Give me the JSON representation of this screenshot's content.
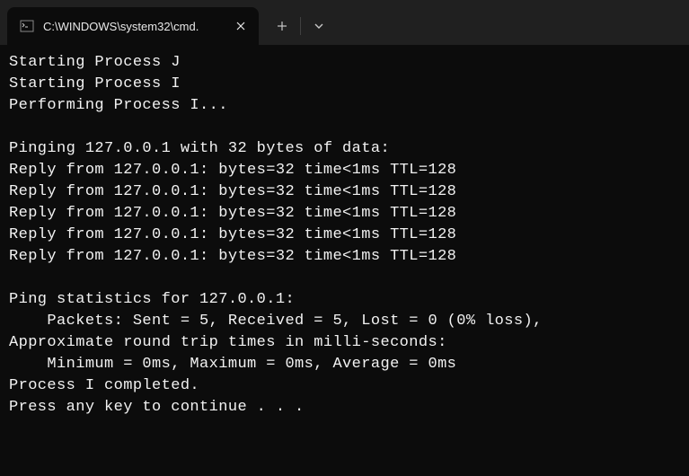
{
  "titlebar": {
    "tab_title": "C:\\WINDOWS\\system32\\cmd."
  },
  "terminal": {
    "lines": [
      "Starting Process J",
      "Starting Process I",
      "Performing Process I...",
      "",
      "Pinging 127.0.0.1 with 32 bytes of data:",
      "Reply from 127.0.0.1: bytes=32 time<1ms TTL=128",
      "Reply from 127.0.0.1: bytes=32 time<1ms TTL=128",
      "Reply from 127.0.0.1: bytes=32 time<1ms TTL=128",
      "Reply from 127.0.0.1: bytes=32 time<1ms TTL=128",
      "Reply from 127.0.0.1: bytes=32 time<1ms TTL=128",
      "",
      "Ping statistics for 127.0.0.1:",
      "    Packets: Sent = 5, Received = 5, Lost = 0 (0% loss),",
      "Approximate round trip times in milli-seconds:",
      "    Minimum = 0ms, Maximum = 0ms, Average = 0ms",
      "Process I completed.",
      "Press any key to continue . . ."
    ]
  }
}
